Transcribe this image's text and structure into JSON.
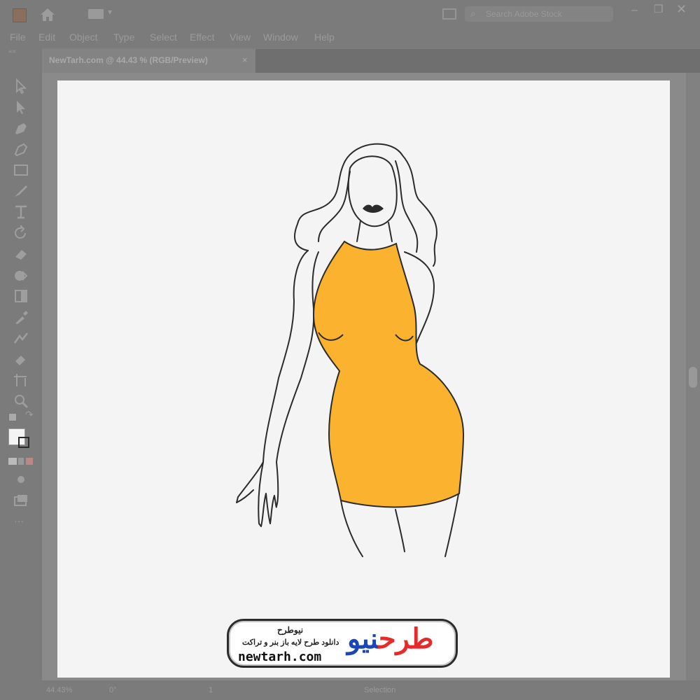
{
  "app": {
    "menu": [
      "File",
      "Edit",
      "Object",
      "Type",
      "Select",
      "Effect",
      "View",
      "Window",
      "Help"
    ],
    "search_placeholder": "Search Adobe Stock",
    "document_tab": "NewTarh.com @ 44.43 % (RGB/Preview)",
    "tab_close": "×"
  },
  "status": {
    "zoom": "44.43%",
    "rotation": "0°",
    "artboard": "1",
    "tool": "Selection"
  },
  "artwork": {
    "dress_color": "#FBB22E",
    "line_color": "#2b2b2b",
    "lips_color": "#2b2b2b"
  },
  "watermark": {
    "brand_fa": "نیو",
    "brand_fa_2": "طرح",
    "title": "نیوطرح",
    "subtitle": "دانلود طرح لایه باز بنر و تراکت",
    "url": "newtarh.com"
  }
}
